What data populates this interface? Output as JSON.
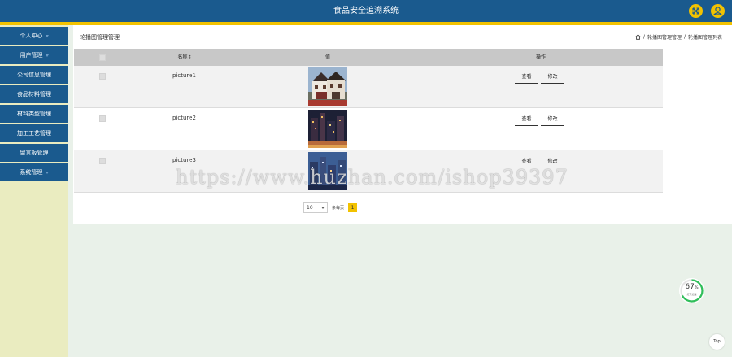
{
  "header": {
    "title": "食品安全追溯系统",
    "icons": [
      "expand-icon",
      "user-icon"
    ],
    "bar_color": "#1a5a8e",
    "accent_color": "#f2c200"
  },
  "sidebar": {
    "items": [
      {
        "label": "个人中心",
        "has_caret": true
      },
      {
        "label": "用户管理",
        "has_caret": true
      },
      {
        "label": "公司信息管理",
        "has_caret": false
      },
      {
        "label": "食品材料管理",
        "has_caret": false
      },
      {
        "label": "材料类型管理",
        "has_caret": false
      },
      {
        "label": "加工工艺管理",
        "has_caret": false
      },
      {
        "label": "留言板管理",
        "has_caret": false
      },
      {
        "label": "系统管理",
        "has_caret": true
      }
    ]
  },
  "page": {
    "title": "轮播图管理管理",
    "breadcrumb": [
      "轮播图管理管理",
      "轮播图管理列表"
    ]
  },
  "table": {
    "headers": {
      "name": "名称",
      "sort_mark": "⇕",
      "value": "值",
      "actions": "操作"
    },
    "rows": [
      {
        "name": "picture1",
        "image": "house-photo"
      },
      {
        "name": "picture2",
        "image": "night-city-photo"
      },
      {
        "name": "picture3",
        "image": "city-lights-photo"
      }
    ],
    "view_label": "查看",
    "edit_label": "修改"
  },
  "pagination": {
    "page_size": "10",
    "total_text": "条每页",
    "current_page": "1"
  },
  "watermark": "https://www.huzhan.com/ishop39397",
  "gauge": {
    "value": "67",
    "unit": "%",
    "sublabel": "打开加速"
  },
  "top_button": "Top"
}
